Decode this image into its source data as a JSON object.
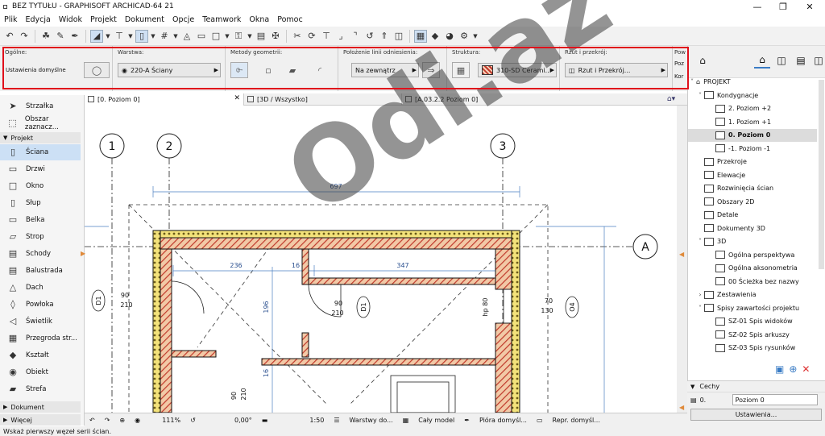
{
  "window": {
    "title": "BEZ TYTUŁU - GRAPHISOFT ARCHICAD-64 21"
  },
  "menu": [
    "Plik",
    "Edycja",
    "Widok",
    "Projekt",
    "Dokument",
    "Opcje",
    "Teamwork",
    "Okna",
    "Pomoc"
  ],
  "infobox": {
    "general_label": "Ogólne:",
    "general_value": "Ustawienia domyślne",
    "layer_label": "Warstwa:",
    "layer_value": "220-A Ściany",
    "geometry_label": "Metody geometrii:",
    "refline_label": "Położenie linii odniesienia:",
    "refline_value": "Na zewnątrz",
    "structure_label": "Struktura:",
    "structure_value": "310-SD Cerami...",
    "floorplan_label": "Rzut i przekrój:",
    "floorplan_value": "Rzut i Przekrój...",
    "extra_label": "Pow",
    "extra_value1": "Poz",
    "extra_value2": "Kor"
  },
  "toolbox": {
    "arrow": "Strzałka",
    "marquee": "Obszar zaznacz...",
    "section_project": "Projekt",
    "tools": [
      "Ściana",
      "Drzwi",
      "Okno",
      "Słup",
      "Belka",
      "Strop",
      "Schody",
      "Balustrada",
      "Dach",
      "Powłoka",
      "Świetlik",
      "Przegroda str...",
      "Kształt",
      "Obiekt",
      "Strefa"
    ],
    "section_document": "Dokument",
    "section_more": "Więcej"
  },
  "tabs": [
    "[0. Poziom 0]",
    "[3D / Wszystko]",
    "[A.03.2.2 Poziom 0]"
  ],
  "navigator": {
    "root": "PROJEKT",
    "items": [
      {
        "label": "Kondygnacje",
        "level": 1,
        "expanded": true
      },
      {
        "label": "2. Poziom +2",
        "level": 2
      },
      {
        "label": "1. Poziom +1",
        "level": 2
      },
      {
        "label": "0. Poziom 0",
        "level": 2,
        "selected": true
      },
      {
        "label": "-1. Poziom -1",
        "level": 2
      },
      {
        "label": "Przekroje",
        "level": 1
      },
      {
        "label": "Elewacje",
        "level": 1
      },
      {
        "label": "Rozwinięcia ścian",
        "level": 1
      },
      {
        "label": "Obszary 2D",
        "level": 1
      },
      {
        "label": "Detale",
        "level": 1
      },
      {
        "label": "Dokumenty 3D",
        "level": 1
      },
      {
        "label": "3D",
        "level": 1,
        "expanded": true
      },
      {
        "label": "Ogólna perspektywa",
        "level": 2
      },
      {
        "label": "Ogólna aksonometria",
        "level": 2
      },
      {
        "label": "00 Ścieżka bez nazwy",
        "level": 2
      },
      {
        "label": "Zestawienia",
        "level": 1
      },
      {
        "label": "Spisy zawartości projektu",
        "level": 1,
        "expanded": true
      },
      {
        "label": "SZ-01 Spis widoków",
        "level": 2
      },
      {
        "label": "SZ-02 Spis arkuszy",
        "level": 2
      },
      {
        "label": "SZ-03 Spis rysunków",
        "level": 2
      }
    ]
  },
  "properties": {
    "header": "Cechy",
    "story_number": "0.",
    "story_name": "Poziom 0",
    "settings_button": "Ustawienia..."
  },
  "statusctl": {
    "zoom": "111%",
    "angle": "0,00°",
    "scale": "1:50",
    "layers": "Warstwy do...",
    "model": "Cały model",
    "pens": "Pióra domyśl...",
    "repr": "Repr. domyśl..."
  },
  "status_message": "Wskaż pierwszy węzeł serii ścian.",
  "drawing": {
    "grid_labels": [
      "1",
      "2",
      "3",
      "A"
    ],
    "dimensions": [
      "697",
      "236",
      "16",
      "347",
      "196",
      "16"
    ],
    "door_labels": [
      "D1",
      "90",
      "210",
      "D1",
      "90",
      "210",
      "90",
      "210"
    ],
    "window_labels": [
      "O4",
      "70",
      "130",
      "hp 80"
    ]
  },
  "watermark": "Odi.az"
}
